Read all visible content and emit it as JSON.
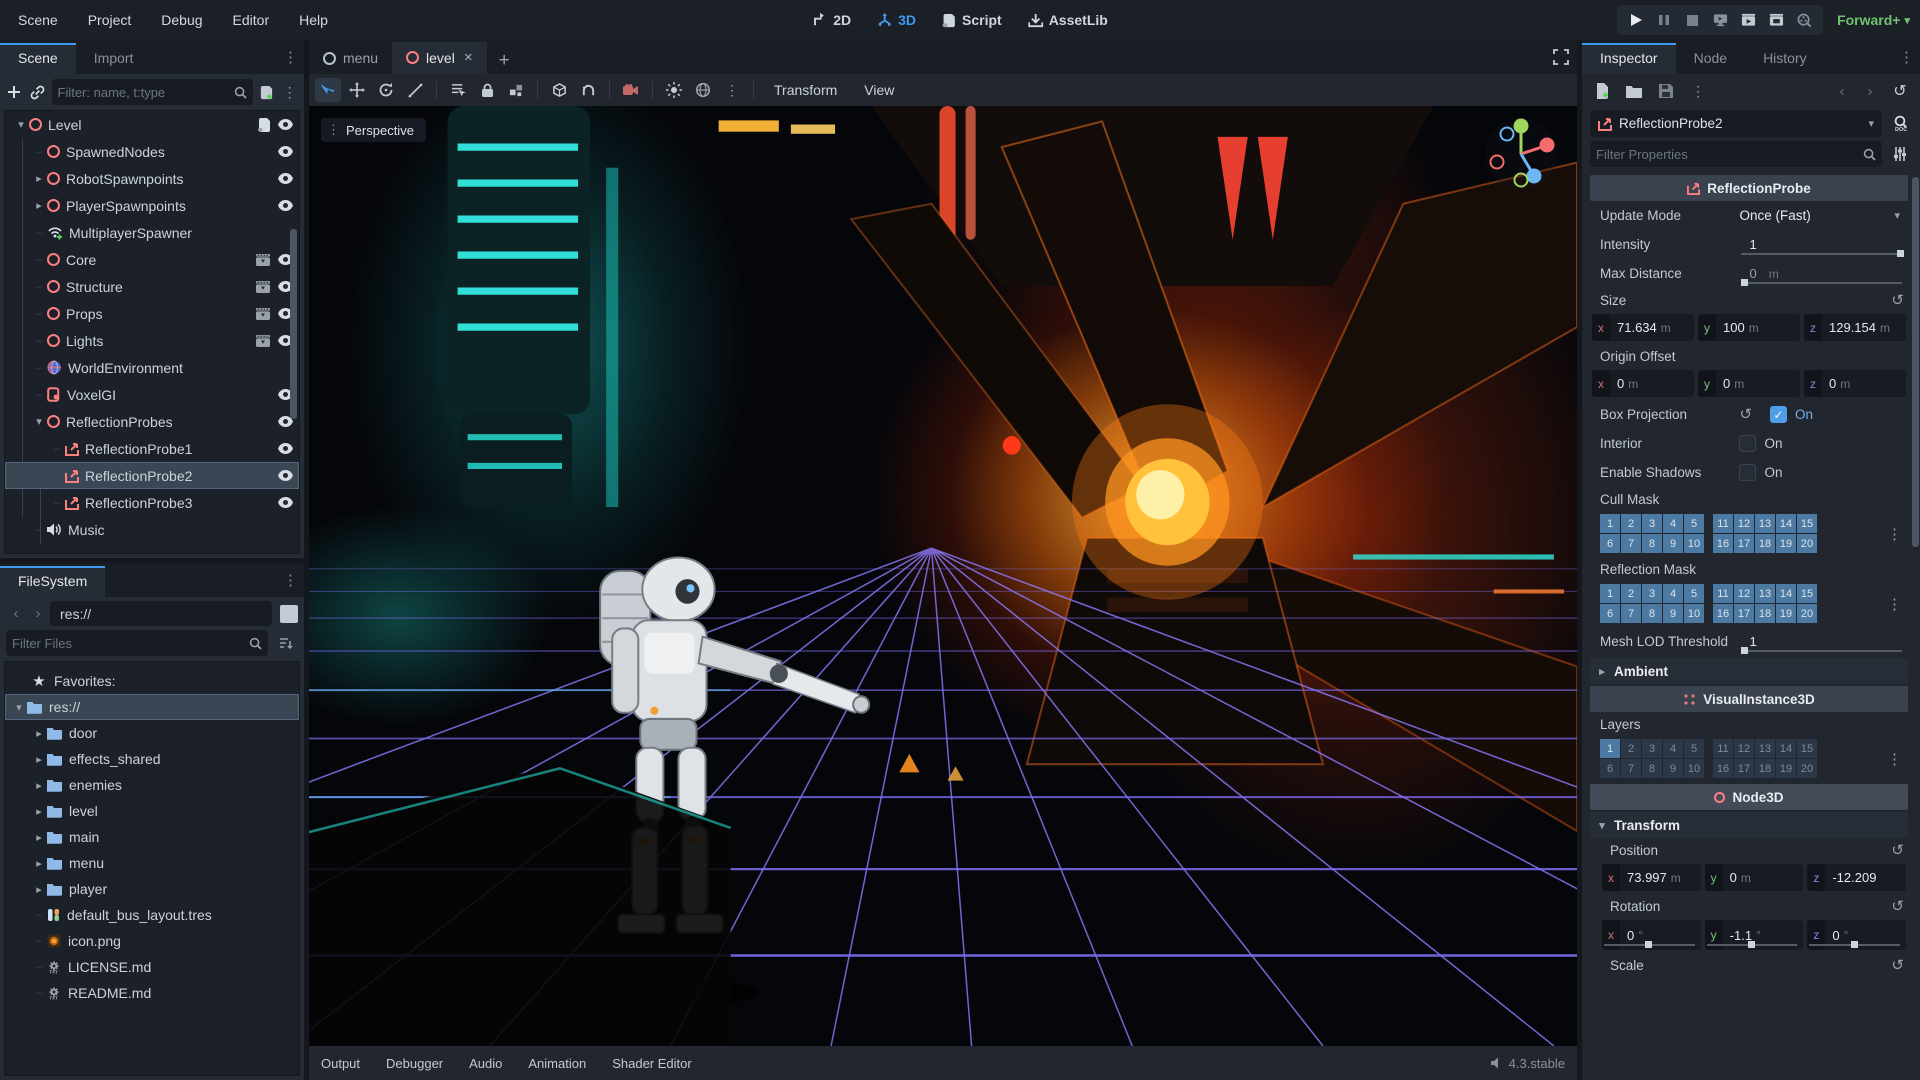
{
  "menubar": {
    "items": [
      "Scene",
      "Project",
      "Debug",
      "Editor",
      "Help"
    ],
    "modes": [
      {
        "label": "2D",
        "active": false
      },
      {
        "label": "3D",
        "active": true
      },
      {
        "label": "Script",
        "active": false
      },
      {
        "label": "AssetLib",
        "active": false
      }
    ],
    "run_icons": [
      "play-icon",
      "pause-icon",
      "stop-icon",
      "remote-debug-icon",
      "play-scene-icon",
      "play-custom-scene-icon",
      "movie-maker-icon"
    ],
    "renderer": "Forward+"
  },
  "scene_dock": {
    "tabs": [
      "Scene",
      "Import"
    ],
    "filter_placeholder": "Filter: name, t:type",
    "toolbar_icons": [
      "add-node-icon",
      "instance-scene-icon",
      "attach-script-icon",
      "more-icon"
    ],
    "tree": [
      {
        "label": "Level",
        "icon": "node3d",
        "depth": 0,
        "arrow": "expanded",
        "badges": [
          "script",
          "eye"
        ]
      },
      {
        "label": "SpawnedNodes",
        "icon": "node3d",
        "depth": 1,
        "badges": [
          "eye"
        ]
      },
      {
        "label": "RobotSpawnpoints",
        "icon": "node3d",
        "depth": 1,
        "arrow": "collapsed",
        "badges": [
          "eye"
        ]
      },
      {
        "label": "PlayerSpawnpoints",
        "icon": "node3d",
        "depth": 1,
        "arrow": "collapsed",
        "badges": [
          "eye"
        ]
      },
      {
        "label": "MultiplayerSpawner",
        "icon": "multiplayer-spawner",
        "depth": 1,
        "badges": []
      },
      {
        "label": "Core",
        "icon": "node3d",
        "depth": 1,
        "badges": [
          "film",
          "eye"
        ]
      },
      {
        "label": "Structure",
        "icon": "node3d",
        "depth": 1,
        "badges": [
          "film",
          "eye"
        ]
      },
      {
        "label": "Props",
        "icon": "node3d",
        "depth": 1,
        "badges": [
          "film",
          "eye"
        ]
      },
      {
        "label": "Lights",
        "icon": "node3d",
        "depth": 1,
        "badges": [
          "film",
          "eye"
        ]
      },
      {
        "label": "WorldEnvironment",
        "icon": "world-environment",
        "depth": 1,
        "badges": []
      },
      {
        "label": "VoxelGI",
        "icon": "voxel-gi",
        "depth": 1,
        "badges": [
          "eye"
        ]
      },
      {
        "label": "ReflectionProbes",
        "icon": "node3d",
        "depth": 1,
        "arrow": "expanded",
        "badges": [
          "eye"
        ]
      },
      {
        "label": "ReflectionProbe1",
        "icon": "reflection-probe",
        "depth": 2,
        "badges": [
          "eye"
        ]
      },
      {
        "label": "ReflectionProbe2",
        "icon": "reflection-probe",
        "depth": 2,
        "selected": true,
        "badges": [
          "eye"
        ]
      },
      {
        "label": "ReflectionProbe3",
        "icon": "reflection-probe",
        "depth": 2,
        "badges": [
          "eye"
        ]
      },
      {
        "label": "Music",
        "icon": "audio-stream-player",
        "depth": 1,
        "badges": []
      }
    ]
  },
  "filesystem": {
    "tab": "FileSystem",
    "path": "res://",
    "filter_placeholder": "Filter Files",
    "favorites_label": "Favorites:",
    "items": [
      {
        "label": "res://",
        "icon": "folder",
        "selected": true,
        "arrow": "expanded"
      },
      {
        "label": "door",
        "icon": "folder",
        "arrow": "collapsed"
      },
      {
        "label": "effects_shared",
        "icon": "folder",
        "arrow": "collapsed"
      },
      {
        "label": "enemies",
        "icon": "folder",
        "arrow": "collapsed"
      },
      {
        "label": "level",
        "icon": "folder",
        "arrow": "collapsed"
      },
      {
        "label": "main",
        "icon": "folder",
        "arrow": "collapsed"
      },
      {
        "label": "menu",
        "icon": "folder",
        "arrow": "collapsed"
      },
      {
        "label": "player",
        "icon": "folder",
        "arrow": "collapsed"
      },
      {
        "label": "default_bus_layout.tres",
        "icon": "bus-layout-file"
      },
      {
        "label": "icon.png",
        "icon": "image-file"
      },
      {
        "label": "LICENSE.md",
        "icon": "text-file"
      },
      {
        "label": "README.md",
        "icon": "text-file"
      }
    ]
  },
  "viewport": {
    "scene_tabs": [
      {
        "label": "menu",
        "active": false
      },
      {
        "label": "level",
        "active": true
      }
    ],
    "toolbar_icons": [
      "select-icon",
      "move-icon",
      "rotate-icon",
      "scale-icon",
      "list-select-icon",
      "lock-icon",
      "group-icon",
      "snap-icon",
      "ik-icon",
      "camera-preview-icon",
      "sun-icon",
      "environment-icon",
      "more-icon"
    ],
    "menus": [
      "Transform",
      "View"
    ],
    "perspective_label": "Perspective"
  },
  "bottom_bar": {
    "tabs": [
      "Output",
      "Debugger",
      "Audio",
      "Animation",
      "Shader Editor"
    ],
    "version": "4.3.stable"
  },
  "inspector": {
    "tabs": [
      "Inspector",
      "Node",
      "History"
    ],
    "node_name": "ReflectionProbe2",
    "filter_placeholder": "Filter Properties",
    "sections": {
      "reflection_probe": "ReflectionProbe",
      "visual_instance": "VisualInstance3D",
      "node3d": "Node3D"
    },
    "props": {
      "update_mode": {
        "label": "Update Mode",
        "value": "Once (Fast)"
      },
      "intensity": {
        "label": "Intensity",
        "value": "1"
      },
      "max_distance": {
        "label": "Max Distance",
        "value": "0",
        "suffix": "m"
      },
      "size": {
        "label": "Size",
        "x": "71.634",
        "y": "100",
        "z": "129.154",
        "suffix": "m"
      },
      "origin_offset": {
        "label": "Origin Offset",
        "x": "0",
        "y": "0",
        "z": "0",
        "suffix": "m"
      },
      "box_projection": {
        "label": "Box Projection",
        "value": "On",
        "checked": true
      },
      "interior": {
        "label": "Interior",
        "value": "On",
        "checked": false
      },
      "enable_shadows": {
        "label": "Enable Shadows",
        "value": "On",
        "checked": false
      },
      "cull_mask": {
        "label": "Cull Mask"
      },
      "reflection_mask": {
        "label": "Reflection Mask"
      },
      "mesh_lod": {
        "label": "Mesh LOD Threshold",
        "value": "1"
      },
      "ambient": {
        "label": "Ambient"
      },
      "layers": {
        "label": "Layers"
      },
      "transform": {
        "label": "Transform"
      },
      "position": {
        "label": "Position",
        "x": "73.997",
        "x_suffix": "m",
        "y": "0",
        "y_suffix": "m",
        "z": "-12.209",
        "z_suffix": ""
      },
      "rotation": {
        "label": "Rotation",
        "x": "0",
        "y": "-1.1",
        "z": "0",
        "suffix": "°"
      },
      "scale": {
        "label": "Scale"
      }
    },
    "masks": {
      "rows": [
        [
          1,
          2,
          3,
          4,
          5,
          11,
          12,
          13,
          14,
          15
        ],
        [
          6,
          7,
          8,
          9,
          10,
          16,
          17,
          18,
          19,
          20
        ]
      ],
      "layers_active": [
        1
      ]
    },
    "colors": {
      "accent": "#3e9bf0",
      "node_red": "#fc7f7f",
      "mask_blue": "#4d7aa2",
      "renderer_green": "#6fc36f"
    }
  }
}
